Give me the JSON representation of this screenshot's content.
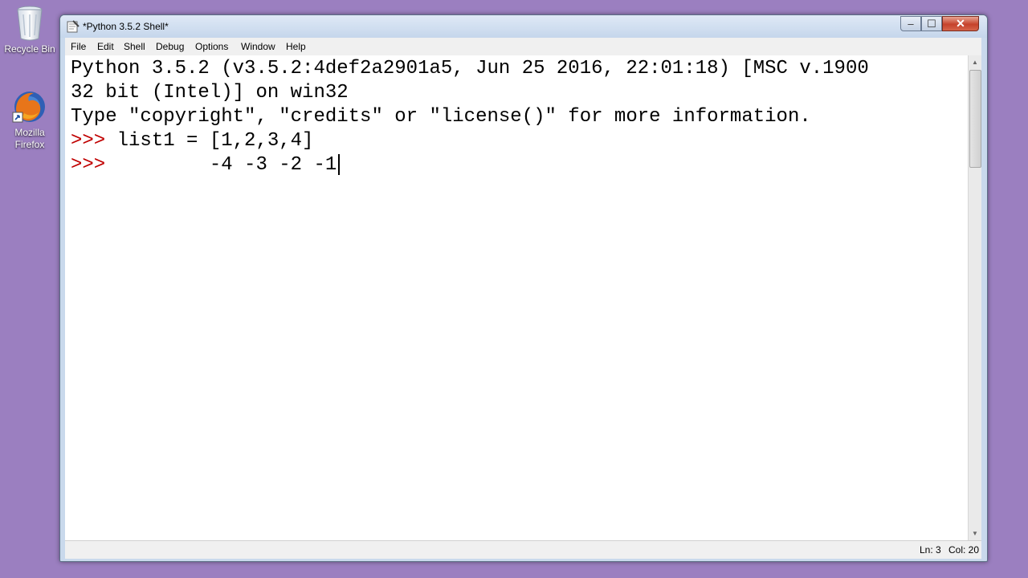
{
  "desktop": {
    "icons": [
      {
        "label": "Recycle Bin",
        "icon": "recycle-bin-icon"
      },
      {
        "label": "Mozilla Firefox",
        "icon": "firefox-icon"
      }
    ]
  },
  "window": {
    "title": "*Python 3.5.2 Shell*",
    "controls": {
      "minimize": "‒",
      "maximize": "☐",
      "close": "✕"
    }
  },
  "menu": [
    "File",
    "Edit",
    "Shell",
    "Debug",
    "Options",
    "Window",
    "Help"
  ],
  "shell": {
    "lines": [
      {
        "prompt": "",
        "text": "Python 3.5.2 (v3.5.2:4def2a2901a5, Jun 25 2016, 22:01:18) [MSC v.1900"
      },
      {
        "prompt": "",
        "text": "32 bit (Intel)] on win32"
      },
      {
        "prompt": "",
        "text": "Type \"copyright\", \"credits\" or \"license()\" for more information."
      },
      {
        "prompt": ">>> ",
        "text": "list1 = [1,2,3,4]"
      },
      {
        "prompt": ">>> ",
        "text": "        -4 -3 -2 -1"
      }
    ]
  },
  "status": {
    "ln": "Ln: 3",
    "col": "Col: 20"
  },
  "colors": {
    "prompt": "#c00000",
    "desktop": "#9b7fc0",
    "editor_bg": "#ffffff"
  }
}
